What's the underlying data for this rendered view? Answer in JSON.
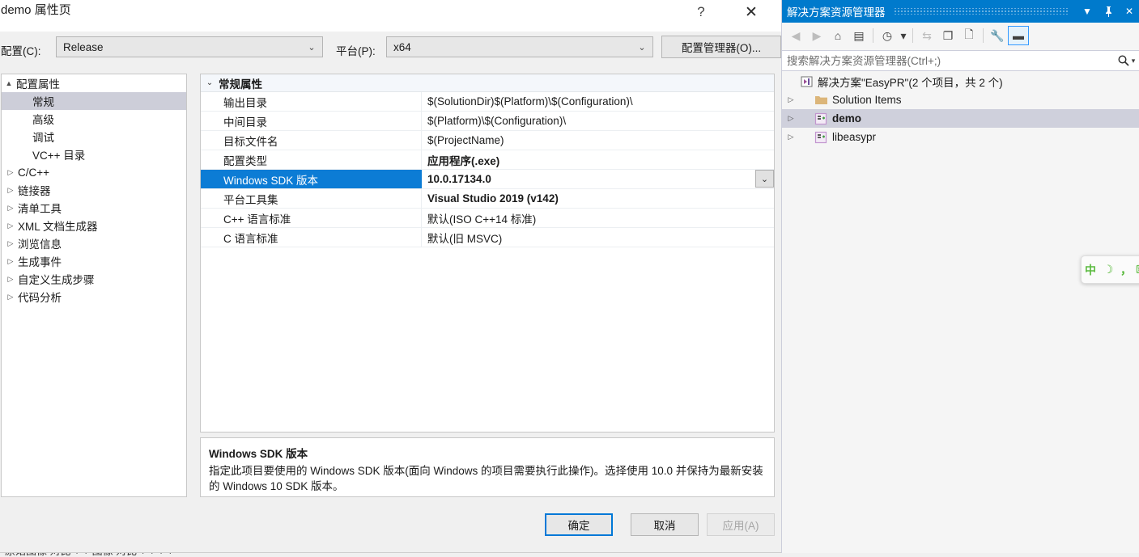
{
  "dialog": {
    "title": "demo 属性页",
    "help_label": "?",
    "close_label": "✕",
    "config_label": "配置(C):",
    "config_value": "Release",
    "platform_label": "平台(P):",
    "platform_value": "x64",
    "config_manager_button": "配置管理器(O)...",
    "buttons": {
      "ok": "确定",
      "cancel": "取消",
      "apply": "应用(A)"
    },
    "accent_color": "#0078d7",
    "selection_color": "#0c7cd5"
  },
  "tree": {
    "root": {
      "label": "配置属性",
      "twisty": "▲"
    },
    "items": [
      {
        "label": "常规",
        "twisty": "",
        "selected": true,
        "indent": 38
      },
      {
        "label": "高级",
        "twisty": "",
        "selected": false,
        "indent": 38
      },
      {
        "label": "调试",
        "twisty": "",
        "selected": false,
        "indent": 38
      },
      {
        "label": "VC++ 目录",
        "twisty": "",
        "selected": false,
        "indent": 38
      },
      {
        "label": "C/C++",
        "twisty": "▷",
        "selected": false,
        "indent": 20
      },
      {
        "label": "链接器",
        "twisty": "▷",
        "selected": false,
        "indent": 20
      },
      {
        "label": "清单工具",
        "twisty": "▷",
        "selected": false,
        "indent": 20
      },
      {
        "label": "XML 文档生成器",
        "twisty": "▷",
        "selected": false,
        "indent": 20
      },
      {
        "label": "浏览信息",
        "twisty": "▷",
        "selected": false,
        "indent": 20
      },
      {
        "label": "生成事件",
        "twisty": "▷",
        "selected": false,
        "indent": 20
      },
      {
        "label": "自定义生成步骤",
        "twisty": "▷",
        "selected": false,
        "indent": 20
      },
      {
        "label": "代码分析",
        "twisty": "▷",
        "selected": false,
        "indent": 20
      }
    ]
  },
  "grid": {
    "group_header": "常规属性",
    "group_twisty": "⌄",
    "rows": [
      {
        "name": "输出目录",
        "value": "$(SolutionDir)$(Platform)\\$(Configuration)\\",
        "bold": false,
        "selected": false,
        "dropdown": false
      },
      {
        "name": "中间目录",
        "value": "$(Platform)\\$(Configuration)\\",
        "bold": false,
        "selected": false,
        "dropdown": false
      },
      {
        "name": "目标文件名",
        "value": "$(ProjectName)",
        "bold": false,
        "selected": false,
        "dropdown": false
      },
      {
        "name": "配置类型",
        "value": "应用程序(.exe)",
        "bold": true,
        "selected": false,
        "dropdown": false
      },
      {
        "name": "Windows SDK 版本",
        "value": "10.0.17134.0",
        "bold": true,
        "selected": true,
        "dropdown": true
      },
      {
        "name": "平台工具集",
        "value": "Visual Studio 2019 (v142)",
        "bold": true,
        "selected": false,
        "dropdown": false
      },
      {
        "name": "C++ 语言标准",
        "value": "默认(ISO C++14 标准)",
        "bold": false,
        "selected": false,
        "dropdown": false
      },
      {
        "name": "C 语言标准",
        "value": "默认(旧 MSVC)",
        "bold": false,
        "selected": false,
        "dropdown": false
      }
    ]
  },
  "description": {
    "title": "Windows SDK 版本",
    "body": "指定此项目要使用的 Windows SDK 版本(面向 Windows 的项目需要执行此操作)。选择使用 10.0 并保持为最新安装的 Windows 10 SDK 版本。"
  },
  "solution_explorer": {
    "title": "解决方案资源管理器",
    "title_bg": "#007acc",
    "window_buttons": {
      "dropdown": "▼",
      "pin": "📌",
      "close": "✕"
    },
    "toolbar": [
      {
        "name": "back-icon",
        "glyph": "◀",
        "disabled": true,
        "active": false
      },
      {
        "name": "forward-icon",
        "glyph": "▶",
        "disabled": true,
        "active": false
      },
      {
        "name": "home-icon",
        "glyph": "⌂",
        "disabled": false,
        "active": false
      },
      {
        "name": "show-all-files-icon",
        "glyph": "▤",
        "disabled": false,
        "active": false
      },
      {
        "name": "pending-changes-icon",
        "glyph": "◷",
        "disabled": false,
        "active": false
      },
      {
        "name": "pending-changes-dropdown-icon",
        "glyph": "▾",
        "disabled": false,
        "active": false
      },
      {
        "name": "sync-icon",
        "glyph": "⇆",
        "disabled": true,
        "active": false
      },
      {
        "name": "refresh-icon",
        "glyph": "❐",
        "disabled": false,
        "active": false
      },
      {
        "name": "view-code-icon",
        "glyph": "🗋",
        "disabled": false,
        "active": false
      },
      {
        "name": "properties-icon",
        "glyph": "🔧",
        "disabled": false,
        "active": false
      },
      {
        "name": "collapse-icon",
        "glyph": "▬",
        "disabled": false,
        "active": true
      }
    ],
    "search_placeholder": "搜索解决方案资源管理器(Ctrl+;)",
    "search_value": "",
    "nodes": [
      {
        "label": "解决方案\"EasyPR\"(2 个项目，共 2 个)",
        "twisty": "",
        "icon": "solution-icon",
        "bold": false,
        "selected": false,
        "indent": 10
      },
      {
        "label": "Solution Items",
        "twisty": "▷",
        "icon": "folder-icon",
        "bold": false,
        "selected": false,
        "indent": 10
      },
      {
        "label": "demo",
        "twisty": "▷",
        "icon": "cpp-project-icon",
        "bold": true,
        "selected": true,
        "indent": 10
      },
      {
        "label": "libeasypr",
        "twisty": "▷",
        "icon": "cpp-project-icon",
        "bold": false,
        "selected": false,
        "indent": 10
      }
    ]
  },
  "ime": {
    "items": [
      {
        "name": "chinese-mode-icon",
        "glyph": "中"
      },
      {
        "name": "moon-icon",
        "glyph": "☽"
      },
      {
        "name": "punctuation-icon",
        "glyph": "，"
      },
      {
        "name": "keyboard-icon",
        "glyph": "⌨"
      }
    ]
  },
  "background": {
    "clipped_text": "原始图像  对比  +  +  图像  对比  +  +  +  +"
  }
}
